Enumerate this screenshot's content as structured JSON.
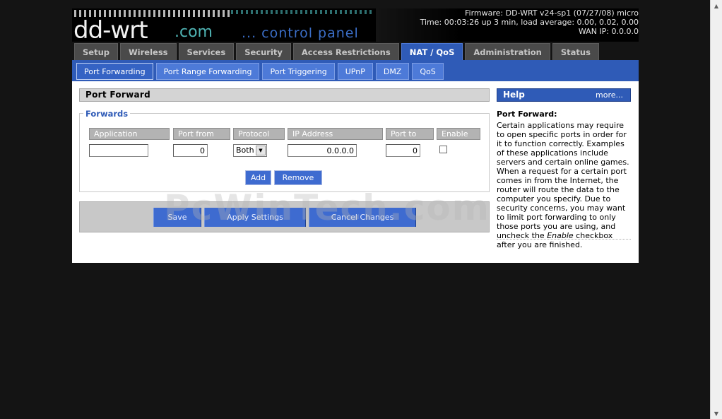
{
  "header": {
    "logo_main": "dd-wrt",
    "logo_dotcom": ".com",
    "logo_tagline": "... control panel",
    "firmware": "Firmware: DD-WRT v24-sp1 (07/27/08) micro",
    "time": "Time: 00:03:26 up 3 min, load average: 0.00, 0.02, 0.00",
    "wan_ip": "WAN IP: 0.0.0.0"
  },
  "main_tabs": [
    "Setup",
    "Wireless",
    "Services",
    "Security",
    "Access Restrictions",
    "NAT / QoS",
    "Administration",
    "Status"
  ],
  "active_main_tab": "NAT / QoS",
  "sub_tabs": [
    "Port Forwarding",
    "Port Range Forwarding",
    "Port Triggering",
    "UPnP",
    "DMZ",
    "QoS"
  ],
  "active_sub_tab": "Port Forwarding",
  "section": {
    "title": "Port Forward",
    "legend": "Forwards",
    "columns": [
      "Application",
      "Port from",
      "Protocol",
      "IP Address",
      "Port to",
      "Enable"
    ],
    "row": {
      "application": "",
      "port_from": "0",
      "protocol": "Both",
      "ip_address": "0.0.0.0",
      "port_to": "0",
      "enable": false
    },
    "add_label": "Add",
    "remove_label": "Remove"
  },
  "actions": {
    "save": "Save",
    "apply": "Apply Settings",
    "cancel": "Cancel Changes"
  },
  "watermark": "PcWinTech.com",
  "help": {
    "title": "Help",
    "more": "more...",
    "heading": "Port Forward:",
    "text_before": "Certain applications may require to open specific ports in order for it to function correctly. Examples of these applications include servers and certain online games. When a request for a certain port comes in from the Internet, the router will route the data to the computer you specify. Due to security concerns, you may want to limit port forwarding to only those ports you are using, and uncheck the ",
    "text_em": "Enable",
    "text_after": " checkbox after you are finished."
  },
  "colors": {
    "accent": "#2f5bb7",
    "tab_inactive": "#4a4a4a",
    "background": "#141414"
  }
}
